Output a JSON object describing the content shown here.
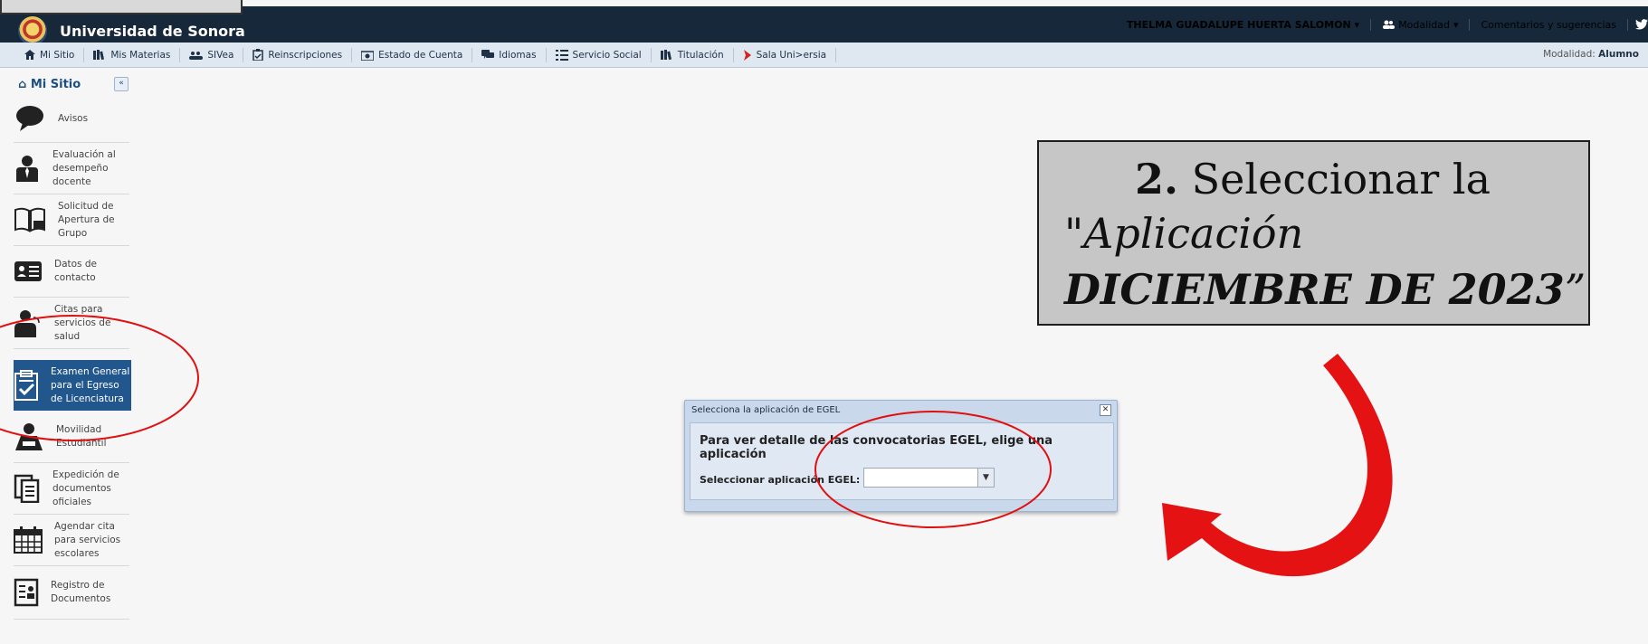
{
  "header": {
    "title": "Universidad de Sonora",
    "user_name": "THELMA GUADALUPE HUERTA SALOMON",
    "modalidad": "Modalidad",
    "comentarios": "Comentarios y sugerencias"
  },
  "navbar": {
    "items": [
      {
        "label": "Mi Sitio",
        "icon": "home-icon"
      },
      {
        "label": "Mis Materias",
        "icon": "books-icon"
      },
      {
        "label": "SIVea",
        "icon": "users-icon"
      },
      {
        "label": "Reinscripciones",
        "icon": "clipboard-icon"
      },
      {
        "label": "Estado de Cuenta",
        "icon": "money-icon"
      },
      {
        "label": "Idiomas",
        "icon": "chat-icon"
      },
      {
        "label": "Servicio Social",
        "icon": "list-icon"
      },
      {
        "label": "Titulación",
        "icon": "books-icon"
      },
      {
        "label": "Sala Uni>ersia",
        "icon": "chevron-right-icon"
      }
    ],
    "modalidad_label": "Modalidad:",
    "modalidad_value": "Alumno"
  },
  "sidebar": {
    "title": "Mi Sitio",
    "items": [
      {
        "label": "Avisos",
        "icon": "speech-bubble-icon"
      },
      {
        "label": "Evaluación al desempeño docente",
        "icon": "teacher-icon"
      },
      {
        "label": "Solicitud de Apertura de Grupo",
        "icon": "open-book-icon"
      },
      {
        "label": "Datos de contacto",
        "icon": "id-card-icon"
      },
      {
        "label": "Citas para servicios de salud",
        "icon": "doctor-icon"
      },
      {
        "label": "Examen General para el Egreso de Licenciatura",
        "icon": "exam-clipboard-icon"
      },
      {
        "label": "Movilidad Estudiantil",
        "icon": "student-mobility-icon"
      },
      {
        "label": "Expedición de documentos oficiales",
        "icon": "documents-icon"
      },
      {
        "label": "Agendar cita para servicios escolares",
        "icon": "calendar-icon"
      },
      {
        "label": "Registro de Documentos",
        "icon": "document-register-icon"
      }
    ]
  },
  "dialog": {
    "title": "Selecciona la aplicación de EGEL",
    "heading": "Para ver detalle de las convocatorias EGEL, elige una aplicación",
    "select_label": "Seleccionar aplicación EGEL:",
    "select_value": ""
  },
  "callout": {
    "step": "2.",
    "text1": " Seleccionar la",
    "quote_open": "\"",
    "italic1": "Aplicación ",
    "bold_italic": "DICIEMBRE DE 2023",
    "quote_close": "”"
  },
  "colors": {
    "topbar": "#16283a",
    "navbar": "#dfe7f1",
    "sidebar_active": "#22578e",
    "annotation_red": "#e01010"
  }
}
